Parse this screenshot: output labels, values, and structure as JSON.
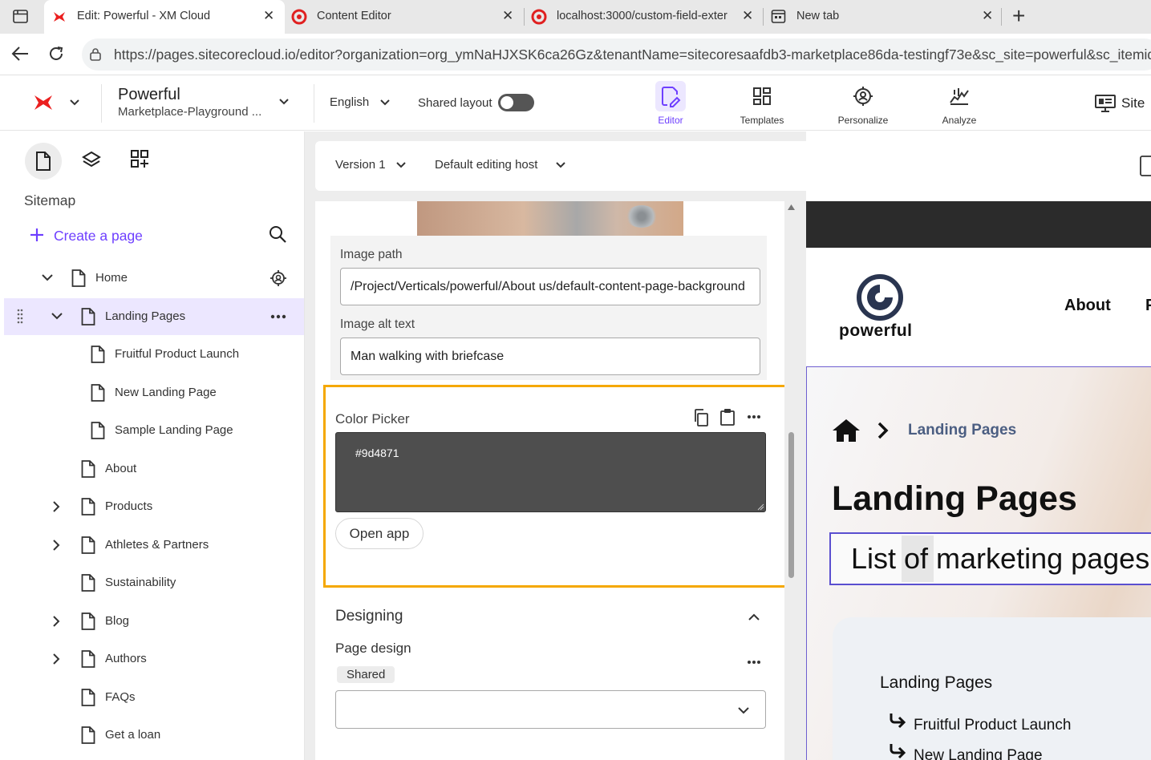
{
  "browser": {
    "tabs": [
      {
        "title": "Edit: Powerful - XM Cloud",
        "active": true
      },
      {
        "title": "Content Editor",
        "active": false
      },
      {
        "title": "localhost:3000/custom-field-exter",
        "active": false
      },
      {
        "title": "New tab",
        "active": false
      }
    ],
    "new_tab_glyph": "+",
    "close_glyph": "✕",
    "url": "https://pages.sitecorecloud.io/editor?organization=org_ymNaHJXSK6ca26Gz&tenantName=sitecoresaafdb3-marketplace86da-testingf73e&sc_site=powerful&sc_itemid"
  },
  "header": {
    "site_name": "Powerful",
    "site_sub": "Marketplace-Playground ...",
    "language": "English",
    "shared_layout_label": "Shared layout",
    "shared_layout_on": false,
    "nav": [
      {
        "label": "Editor",
        "icon": "editor-icon",
        "active": true
      },
      {
        "label": "Templates",
        "icon": "templates-icon",
        "active": false
      },
      {
        "label": "Personalize",
        "icon": "personalize-icon",
        "active": false
      },
      {
        "label": "Analyze",
        "icon": "analyze-icon",
        "active": false
      }
    ],
    "site_button": "Site",
    "accent": "#6e3fff",
    "brand_red": "#eb1f1f"
  },
  "sidebar": {
    "title": "Sitemap",
    "create_label": "Create a page",
    "tree": [
      {
        "label": "Home",
        "level": 0,
        "expand": "open"
      },
      {
        "label": "Landing Pages",
        "level": 1,
        "expand": "open",
        "selected": true
      },
      {
        "label": "Fruitful Product Launch",
        "level": 2,
        "expand": "none"
      },
      {
        "label": "New Landing Page",
        "level": 2,
        "expand": "none"
      },
      {
        "label": "Sample Landing Page",
        "level": 2,
        "expand": "none"
      },
      {
        "label": "About",
        "level": 1,
        "expand": "none"
      },
      {
        "label": "Products",
        "level": 1,
        "expand": "closed"
      },
      {
        "label": "Athletes & Partners",
        "level": 1,
        "expand": "closed"
      },
      {
        "label": "Sustainability",
        "level": 1,
        "expand": "none"
      },
      {
        "label": "Blog",
        "level": 1,
        "expand": "closed"
      },
      {
        "label": "Authors",
        "level": 1,
        "expand": "closed"
      },
      {
        "label": "FAQs",
        "level": 1,
        "expand": "none"
      },
      {
        "label": "Get a loan",
        "level": 1,
        "expand": "none"
      }
    ]
  },
  "toolbar": {
    "version": "Version 1",
    "host": "Default editing host"
  },
  "fields": {
    "image_path_label": "Image path",
    "image_path_value": "/Project/Verticals/powerful/About us/default-content-page-background",
    "image_alt_label": "Image alt text",
    "image_alt_value": "Man walking with briefcase",
    "color_picker_label": "Color Picker",
    "color_value": "#9d4871",
    "open_app_label": "Open app",
    "highlight_color": "#f5a800"
  },
  "designing": {
    "section_title": "Designing",
    "page_design_label": "Page design",
    "shared_badge": "Shared",
    "select_value": ""
  },
  "preview": {
    "logo_text": "powerful",
    "nav_about": "About",
    "nav_next": "P",
    "breadcrumb": "Landing Pages",
    "heading": "Landing Pages",
    "subheading": "List of marketing pages f",
    "list_title": "Landing Pages",
    "list_items": [
      "Fruitful Product Launch",
      "New Landing Page"
    ]
  }
}
